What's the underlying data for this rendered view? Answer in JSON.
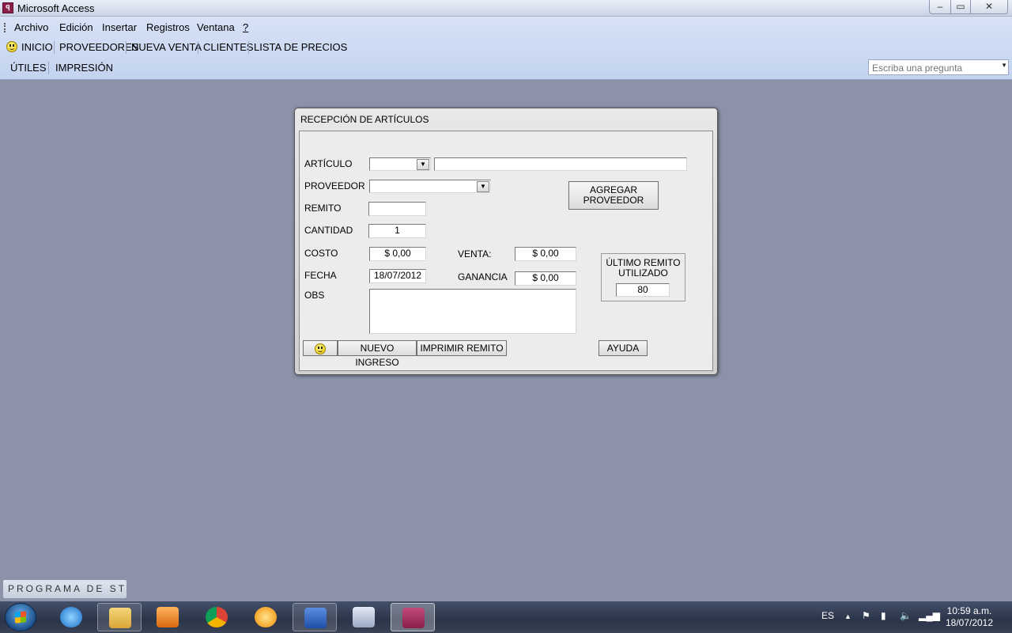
{
  "window": {
    "title": "Microsoft Access",
    "minimize": "–",
    "maximize": "▭",
    "close": "✕"
  },
  "menubar": {
    "items": [
      {
        "label": "Archivo"
      },
      {
        "label": "Edición"
      },
      {
        "label": "Insertar"
      },
      {
        "label": "Registros"
      },
      {
        "label": "Ventana"
      },
      {
        "label": "?"
      }
    ]
  },
  "toolbar1": {
    "items": [
      "INICIO",
      "PROVEEDORES",
      "NUEVA VENTA",
      "CLIENTES",
      "LISTA DE PRECIOS"
    ]
  },
  "toolbar2": {
    "items": [
      "ÚTILES",
      "IMPRESIÓN"
    ]
  },
  "help_box": {
    "placeholder": "Escriba una pregunta"
  },
  "dialog": {
    "title": "RECEPCIÓN DE ARTÍCULOS",
    "labels": {
      "articulo": "ARTÍCULO",
      "proveedor": "PROVEEDOR",
      "remito": "REMITO",
      "cantidad": "CANTIDAD",
      "costo": "COSTO",
      "fecha": "FECHA",
      "obs": "OBS",
      "venta": "VENTA:",
      "ganancia": "GANANCIA"
    },
    "values": {
      "articulo_code": "",
      "articulo_desc": "",
      "proveedor": "",
      "remito": "",
      "cantidad": "1",
      "costo": "$ 0,00",
      "fecha": "18/07/2012",
      "obs": "",
      "venta": "$ 0,00",
      "ganancia": "$ 0,00"
    },
    "buttons": {
      "agregar_proveedor": "AGREGAR PROVEEDOR",
      "nuevo_ingreso": "NUEVO INGRESO",
      "imprimir_remito": "IMPRIMIR REMITO",
      "ayuda": "AYUDA"
    },
    "ultimo_remito": {
      "label": "ÚLTIMO REMITO UTILIZADO",
      "value": "80"
    }
  },
  "minimized_window": {
    "label": "PROGRAMA DE ST..."
  },
  "taskbar": {
    "apps": [
      "start",
      "internet-explorer",
      "explorer",
      "media-player",
      "chrome",
      "messenger",
      "word",
      "calculator",
      "access"
    ],
    "tray": {
      "language": "ES",
      "time": "10:59 a.m.",
      "date": "18/07/2012"
    }
  },
  "colors": {
    "desktop": "#8c92a8",
    "menubar": "#c3d3ef",
    "dialog": "#ececec",
    "taskbar": "#2b3448"
  }
}
